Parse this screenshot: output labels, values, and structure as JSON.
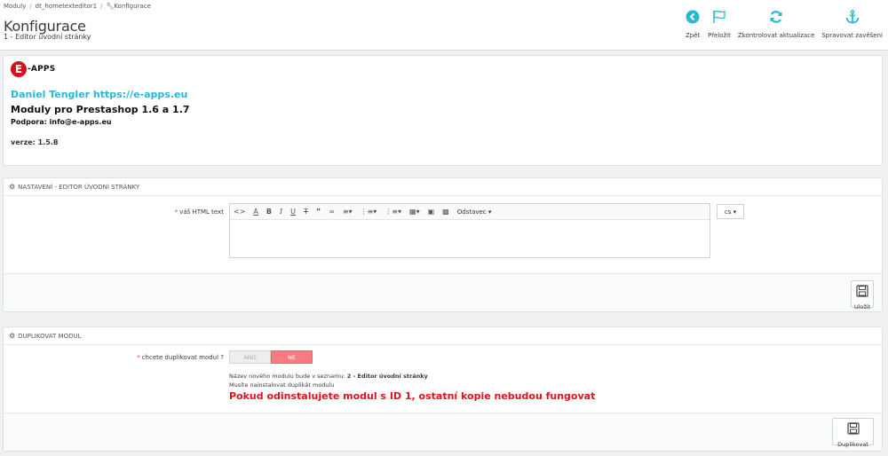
{
  "header": {
    "breadcrumb": [
      "Moduly",
      "dt_hometexteditor1",
      "Konfigurace"
    ],
    "title": "Konfigurace",
    "subtitle": "1 - Editor úvodní stránky",
    "toolbar": [
      {
        "label": "Zpět",
        "icon": "arrow-left-circle-icon"
      },
      {
        "label": "Přeložit",
        "icon": "flag-icon"
      },
      {
        "label": "Zkontrolovat aktualizace",
        "icon": "refresh-icon"
      },
      {
        "label": "Spravovat zavěšení",
        "icon": "anchor-icon"
      }
    ]
  },
  "info": {
    "logo_letter": "E",
    "logo_text": "-APPS",
    "author": "Daniel Tengler https://e-apps.eu",
    "modules": "Moduly pro Prestashop 1.6 a 1.7",
    "support": "Podpora: info@e-apps.eu",
    "version": "verze: 1.5.8"
  },
  "settings": {
    "heading": "NASTAVENÍ - EDITOR ÚVODNÍ STRÁNKY",
    "html_label": "váš HTML text",
    "format_label": "Odstavec",
    "lang": "cs",
    "save_label": "Uložit"
  },
  "duplicate": {
    "heading": "DUPLIKOVAT MODUL",
    "question": "chcete duplikovat modul ?",
    "yes": "ANO",
    "no": "NE",
    "selected": "NE",
    "note_prefix": "Název nového modulu bude v seznamu:",
    "note_name": "2 - Editor úvodní stránky",
    "note2": "Musíte nainstalovat duplikát modulu",
    "warning": "Pokud odinstalujete modul s ID 1, ostatní kopie nebudou fungovat",
    "button_label": "Duplikovat"
  },
  "colors": {
    "accent": "#25b9d7",
    "danger": "#e3101e",
    "toggle_no": "#f87a82"
  }
}
